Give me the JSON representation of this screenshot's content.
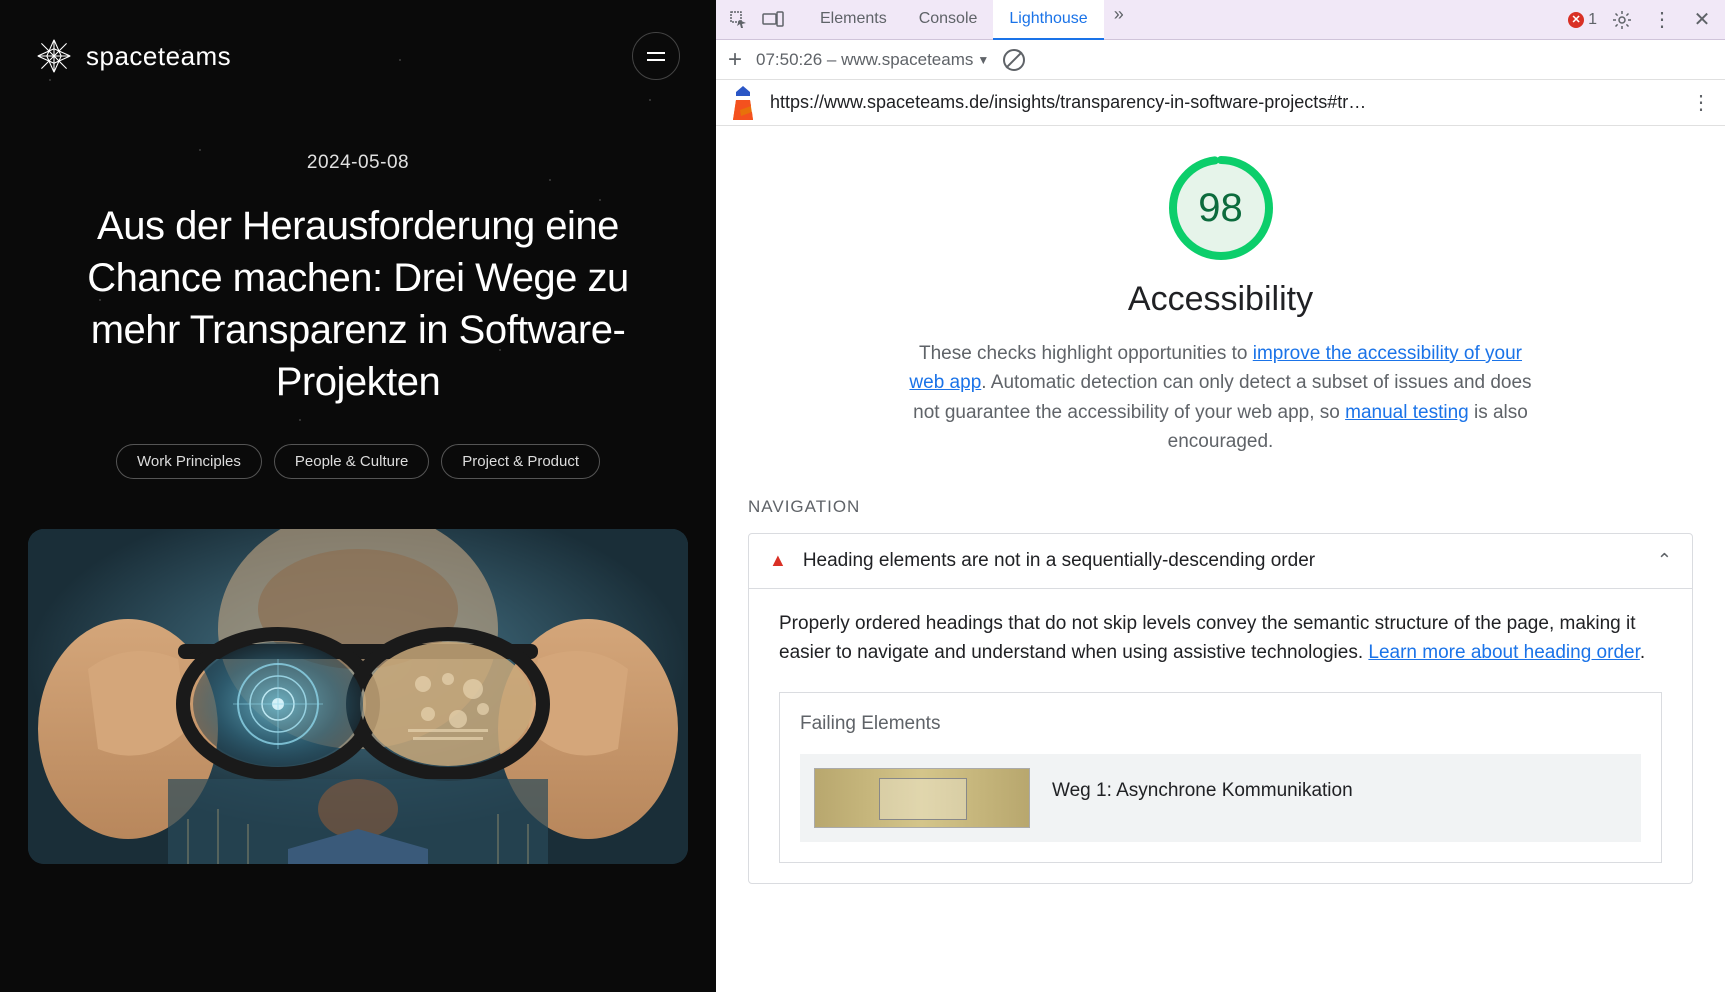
{
  "site": {
    "logo_text": "spaceteams",
    "date": "2024-05-08",
    "title": "Aus der Herausforderung eine Chance machen: Drei Wege zu mehr Transparenz in Software-Projekten",
    "tags": [
      "Work Principles",
      "People & Culture",
      "Project & Product"
    ]
  },
  "devtools": {
    "tabs": [
      "Elements",
      "Console",
      "Lighthouse"
    ],
    "active_tab": "Lighthouse",
    "error_count": "1",
    "timestamp": "07:50:26 – www.spaceteams",
    "url": "https://www.spaceteams.de/insights/transparency-in-software-projects#tr…",
    "score": "98",
    "score_title": "Accessibility",
    "desc_1": "These checks highlight opportunities to ",
    "desc_link1": "improve the accessibility of your web app",
    "desc_2": ". Automatic detection can only detect a subset of issues and does not guarantee the accessibility of your web app, so ",
    "desc_link2": "manual testing",
    "desc_3": " is also encouraged.",
    "section": "NAVIGATION",
    "audit_title": "Heading elements are not in a sequentially-descending order",
    "audit_desc_1": "Properly ordered headings that do not skip levels convey the semantic structure of the page, making it easier to navigate and understand when using assistive technologies. ",
    "audit_link": "Learn more about heading order",
    "audit_desc_2": ".",
    "failing_label": "Failing Elements",
    "failing_item": "Weg 1: Asynchrone Kommunikation"
  }
}
